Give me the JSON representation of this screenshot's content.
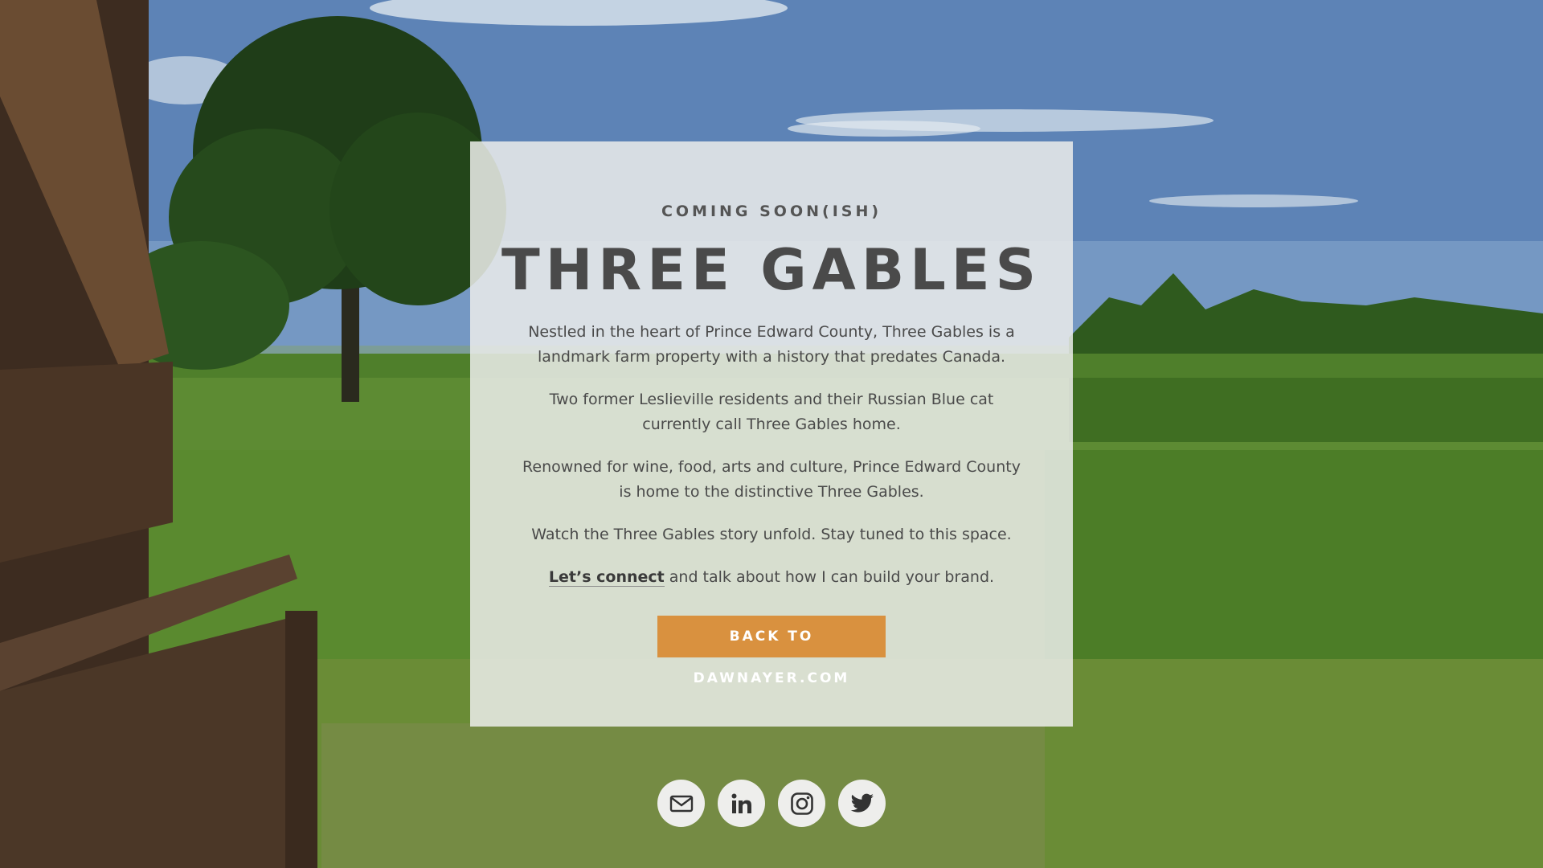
{
  "hero": {
    "eyebrow": "COMING SOON(ISH)",
    "title": "THREE GABLES",
    "paragraphs": [
      "Nestled in the heart of Prince Edward County, Three Gables is a landmark farm property with a history that predates Canada.",
      "Two former Leslieville residents and their Russian Blue cat currently call Three Gables home.",
      "Renowned for wine, food, arts and culture, Prince Edward County is home to the distinctive Three Gables.",
      "Watch the Three Gables story unfold. Stay tuned to this space."
    ],
    "connect_link": "Let’s connect",
    "connect_rest": " and talk about how I can build your brand.",
    "cta_label": "BACK TO DAWNAYER.COM"
  },
  "social": [
    {
      "icon": "mail-icon"
    },
    {
      "icon": "linkedin-icon"
    },
    {
      "icon": "instagram-icon"
    },
    {
      "icon": "twitter-icon"
    }
  ],
  "colors": {
    "accent": "#d9913f",
    "text": "#4a4a4a",
    "card": "#ebeceaDB"
  }
}
